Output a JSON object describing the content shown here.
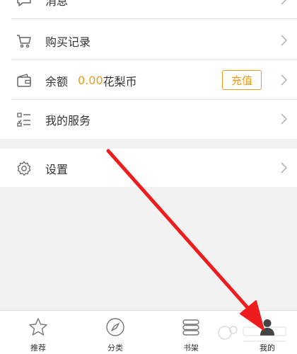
{
  "menu": {
    "messages": {
      "label": "消息",
      "icon": "message-icon"
    },
    "purchase_history": {
      "label": "购买记录",
      "icon": "cart-icon"
    },
    "balance": {
      "label": "余额",
      "amount": "0.00",
      "unit": "花梨币",
      "topup_label": "充值",
      "icon": "wallet-icon"
    },
    "my_services": {
      "label": "我的服务",
      "icon": "service-list-icon"
    },
    "settings": {
      "label": "设置",
      "icon": "gear-icon"
    }
  },
  "tabbar": {
    "items": [
      {
        "label": "推荐",
        "icon": "star-icon",
        "active": false
      },
      {
        "label": "分类",
        "icon": "compass-icon",
        "active": false
      },
      {
        "label": "书架",
        "icon": "bookshelf-icon",
        "active": false
      },
      {
        "label": "我的",
        "icon": "user-icon",
        "active": true
      }
    ]
  },
  "colors": {
    "accent": "#f39a1e",
    "annotation_arrow": "#ee1c1c",
    "text": "#333333",
    "background": "#f2f2f2"
  }
}
